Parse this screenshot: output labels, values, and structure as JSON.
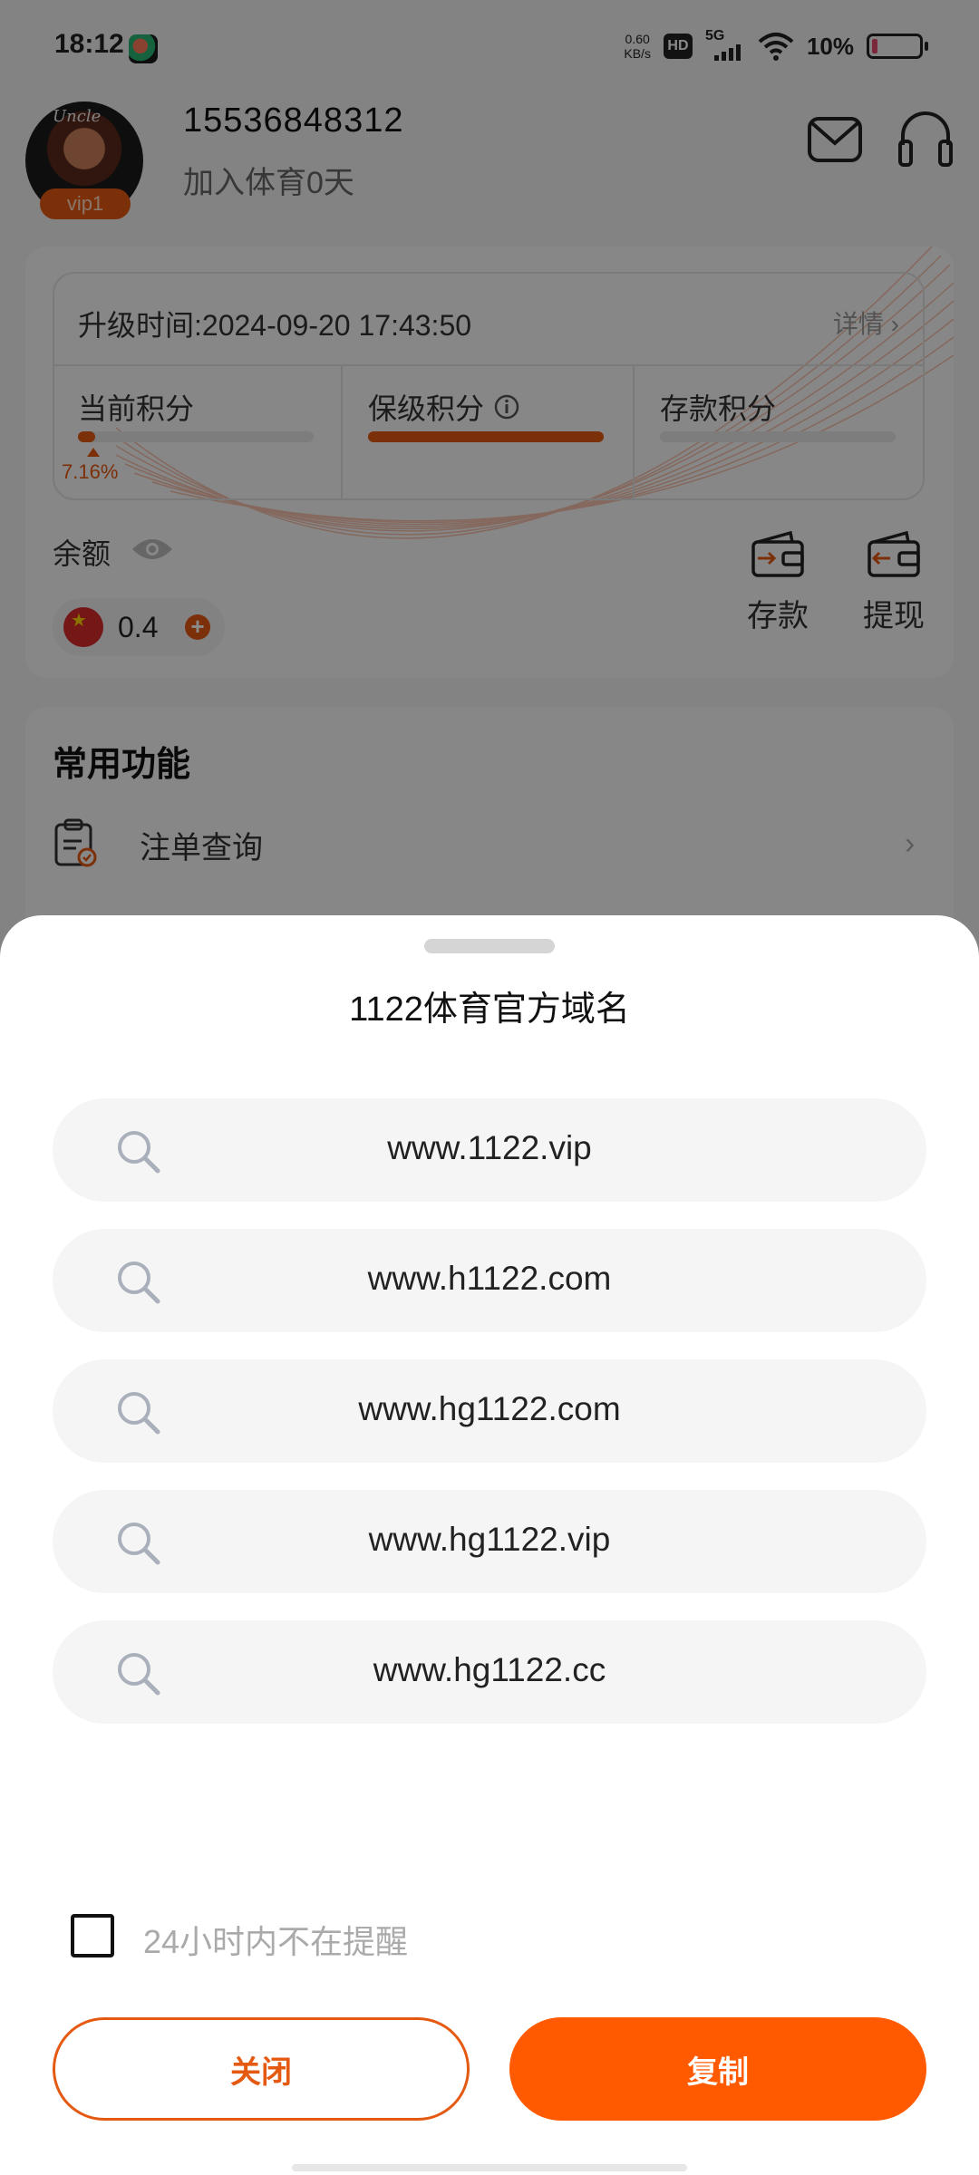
{
  "status_bar": {
    "time": "18:12",
    "net_speed_value": "0.60",
    "net_speed_unit": "KB/s",
    "hd": "HD",
    "network": "5G",
    "battery": "10%"
  },
  "profile": {
    "avatar_scribble": "Uncle",
    "vip_level": "vip1",
    "phone": "15536848312",
    "joined": "加入体育0天"
  },
  "vip_card": {
    "upgrade_time": "升级时间:2024-09-20 17:43:50",
    "detail_label": "详情",
    "current_points": {
      "label": "当前积分",
      "progress": 0.0716,
      "percent_label": "7.16%"
    },
    "keep_points": {
      "label": "保级积分",
      "progress": 1.0
    },
    "deposit_points": {
      "label": "存款积分",
      "progress": 0
    }
  },
  "balance": {
    "label": "余额",
    "value": "0.4",
    "deposit_label": "存款",
    "withdraw_label": "提现"
  },
  "functions": {
    "title": "常用功能",
    "items": [
      {
        "label": "注单查询",
        "icon": "clipboard-icon"
      }
    ]
  },
  "sheet": {
    "title": "1122体育官方域名",
    "domains": [
      "www.1122.vip",
      "www.h1122.com",
      "www.hg1122.com",
      "www.hg1122.vip",
      "www.hg1122.cc"
    ],
    "dont_remind_label": "24小时内不在提醒",
    "dont_remind_checked": false,
    "close_label": "关闭",
    "copy_label": "复制"
  },
  "colors": {
    "accent": "#ff5a00",
    "progress": "#e55a12"
  }
}
